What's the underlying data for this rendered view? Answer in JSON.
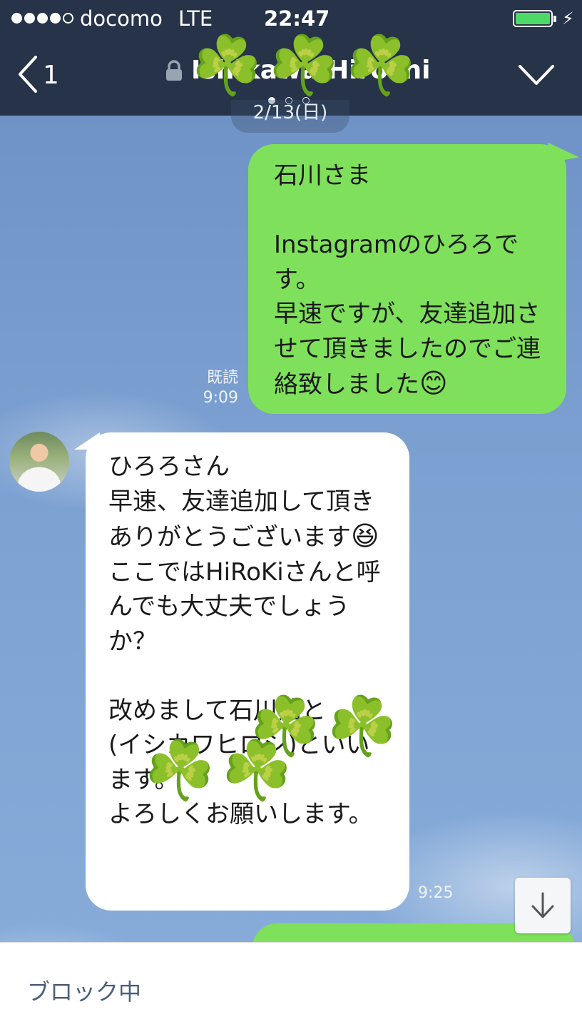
{
  "status_bar": {
    "carrier": "docomo",
    "network": "LTE",
    "time": "22:47",
    "signal_bars_filled": 4,
    "signal_bars_total": 5,
    "battery_color": "#4cd964"
  },
  "header": {
    "back_count": "1",
    "title": "Ishikawa Hiroshi",
    "lock_icon": "lock-icon",
    "dropdown_icon": "chevron-down-icon",
    "page_dots_total": 3,
    "page_dots_active": 1,
    "background_color": "#263349",
    "decoration": "four-leaf-clover stickers"
  },
  "date_separator": "2/13(日)",
  "messages": [
    {
      "direction": "outgoing",
      "text": "石川さま\n\nInstagramのひろろです。\n早速ですが、友達追加させて頂きましたのでご連絡致しました",
      "emoji": "😊",
      "read_label": "既読",
      "time": "9:09",
      "bubble_color": "#7fe15b"
    },
    {
      "direction": "incoming",
      "text_part1": "ひろろさん\n早速、友達追加して頂きありがとうございます",
      "emoji": "😆",
      "text_part2": "\nここではHiRoKiさんと呼んでも大丈夫でしょうか？\n\n改めまして石川浩と\n(イシカワヒロシ)といいます。\nよろしくお願いします。",
      "time": "9:25",
      "bubble_color": "#ffffff"
    }
  ],
  "scroll_down_icon": "arrow-down-icon",
  "bottom_bar": {
    "status_label": "ブロック中"
  }
}
